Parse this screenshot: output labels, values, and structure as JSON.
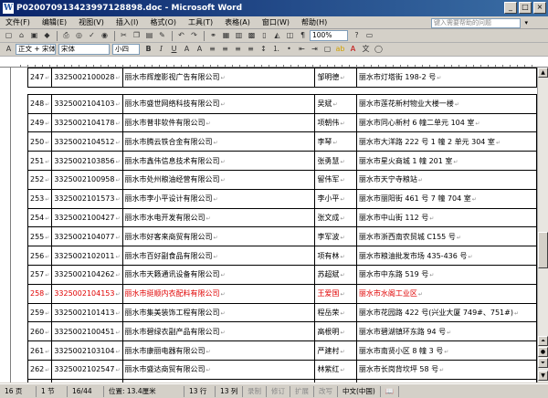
{
  "window": {
    "title": "P020070913423997128898.doc - Microsoft Word"
  },
  "menu": [
    "文件(F)",
    "编辑(E)",
    "视图(V)",
    "插入(I)",
    "格式(O)",
    "工具(T)",
    "表格(A)",
    "窗口(W)",
    "帮助(H)"
  ],
  "help_box": {
    "placeholder": "键入需要帮助的问题"
  },
  "toolbar": {
    "zoom": "100%",
    "style": "正文 + 宋体",
    "font": "宋体",
    "size": "小四"
  },
  "table": {
    "rows": [
      {
        "n": "247",
        "code": "3325002100028",
        "name": "丽水市辉煌影视广告有限公司",
        "person": "邹明德",
        "addr": "丽水市灯塔街 198-2 号",
        "red": false
      },
      {
        "n": "248",
        "code": "3325002104103",
        "name": "丽水市盛世网络科技有限公司",
        "person": "吴斌",
        "addr": "丽水市莲花新村物业大楼一楼",
        "red": false
      },
      {
        "n": "249",
        "code": "3325002104178",
        "name": "丽水市普非软件有限公司",
        "person": "项朝伟",
        "addr": "丽水市同心新村 6 幢二单元 104 室",
        "red": false
      },
      {
        "n": "250",
        "code": "3325002104512",
        "name": "丽水市腾云铁合金有限公司",
        "person": "李琴",
        "addr": "丽水市大洋路 222 号 1 幢 2 单元 304 室",
        "red": false
      },
      {
        "n": "251",
        "code": "3325002103856",
        "name": "丽水市鑫伟信息技术有限公司",
        "person": "张勇慧",
        "addr": "丽水市星火商城 1 幢 201 室",
        "red": false
      },
      {
        "n": "252",
        "code": "3325002100958",
        "name": "丽水市处州粮油经营有限公司",
        "person": "留伟军",
        "addr": "丽水市天宁寺粮站",
        "red": false
      },
      {
        "n": "253",
        "code": "3325002101573",
        "name": "丽水市李小平设计有限公司",
        "person": "李小平",
        "addr": "丽水市丽阳街 461 号 7 幢 704 室",
        "red": false
      },
      {
        "n": "254",
        "code": "3325002100427",
        "name": "丽水市水电开发有限公司",
        "person": "张文成",
        "addr": "丽水市中山街 112 号",
        "red": false
      },
      {
        "n": "255",
        "code": "3325002104077",
        "name": "丽水市好客来商贸有限公司",
        "person": "李军波",
        "addr": "丽水市浙西南农贸城 C155 号",
        "red": false
      },
      {
        "n": "256",
        "code": "3325002102011",
        "name": "丽水市百好副食品有限公司",
        "person": "项有林",
        "addr": "丽水市粮油批发市场 435-436 号",
        "red": false
      },
      {
        "n": "257",
        "code": "3325002104262",
        "name": "丽水市天籁通讯设备有限公司",
        "person": "苏超斌",
        "addr": "丽水市中东路 519 号",
        "red": false
      },
      {
        "n": "258",
        "code": "3325002104153",
        "name": "丽水市挺顺内衣配料有限公司",
        "person": "王爱国",
        "addr": "丽水市水阁工业区",
        "red": true
      },
      {
        "n": "259",
        "code": "3325002101413",
        "name": "丽水市集美装饰工程有限公司",
        "person": "程岳荣",
        "addr": "丽水市花园路 422 号(兴业大厦 749#、751#)",
        "red": false
      },
      {
        "n": "260",
        "code": "3325002100451",
        "name": "丽水市碧绿衣副产品有限公司",
        "person": "高根明",
        "addr": "丽水市碧湖镇环东路 94 号",
        "red": false
      },
      {
        "n": "261",
        "code": "3325002103104",
        "name": "丽水市康丽电器有限公司",
        "person": "严建村",
        "addr": "丽水市南贤小区 8 幢 3 号",
        "red": false
      },
      {
        "n": "262",
        "code": "3325002102547",
        "name": "丽水市盛达商贸有限公司",
        "person": "林紫红",
        "addr": "丽水市长岗背坎坪 58 号",
        "red": false
      },
      {
        "n": "",
        "code": "3311000000007",
        "name": "",
        "person": "",
        "addr": "",
        "red": false
      }
    ]
  },
  "status": {
    "page": "16 页",
    "section": "1 节",
    "pages": "16/44",
    "position": "位置: 13.4厘米",
    "line": "13 行",
    "col": "13 列",
    "rec": "录制",
    "trk": "修订",
    "ext": "扩展",
    "ovr": "改写",
    "lang": "中文(中国)"
  }
}
